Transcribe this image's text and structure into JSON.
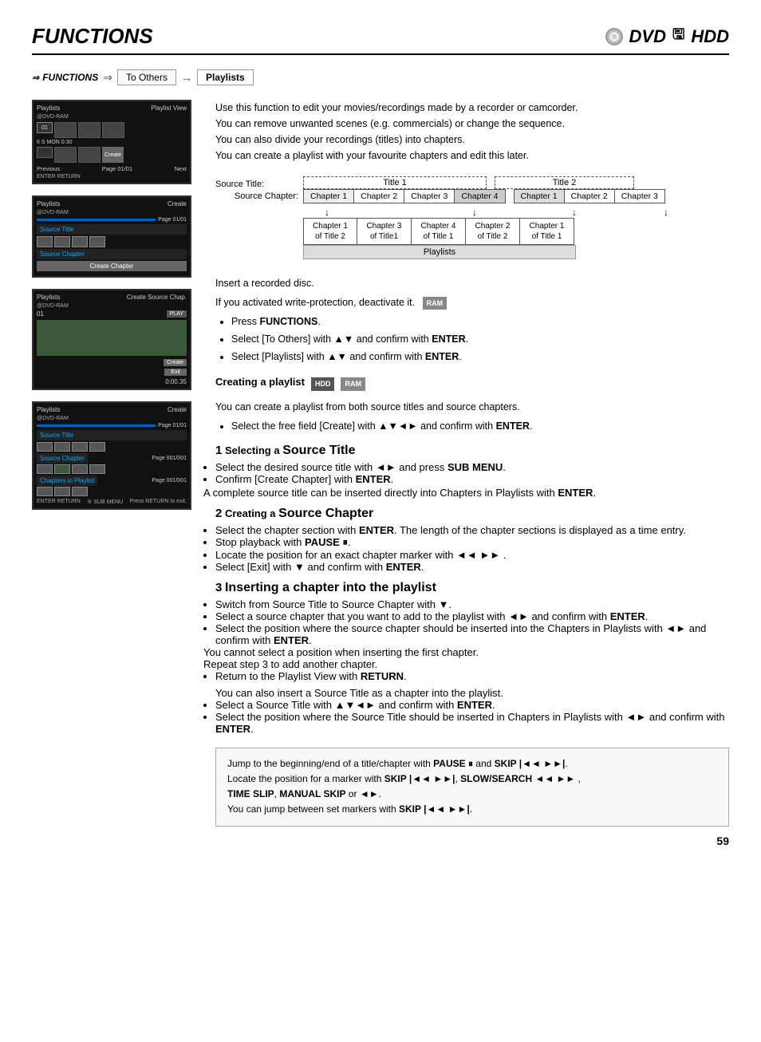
{
  "header": {
    "title": "FUNCTIONS",
    "dvd_label": "DVD",
    "hdd_label": "HDD"
  },
  "breadcrumb": {
    "functions": "FUNCTIONS",
    "to_others": "To Others",
    "playlists": "Playlists"
  },
  "description": [
    "Use this function to edit your movies/recordings made by a recorder or camcorder.",
    "You can remove unwanted scenes (e.g. commercials) or change the sequence.",
    "You can also divide your recordings (titles) into chapters.",
    "You can create a playlist with your favourite chapters and edit this later."
  ],
  "diagram": {
    "source_title_label": "Source Title:",
    "source_chapter_label": "Source Chapter:",
    "title1": "Title 1",
    "title2": "Title 2",
    "chapters_title1": [
      "Chapter 1",
      "Chapter 2",
      "Chapter 3",
      "Chapter 4"
    ],
    "chapters_title2": [
      "Chapter 1",
      "Chapter 2",
      "Chapter 3"
    ],
    "playlist_items": [
      {
        "line1": "Chapter 1",
        "line2": "of Title 2"
      },
      {
        "line1": "Chapter 3",
        "line2": "of Title1"
      },
      {
        "line1": "Chapter 4",
        "line2": "of Title 1"
      },
      {
        "line1": "Chapter 2",
        "line2": "of Title 2"
      },
      {
        "line1": "Chapter 1",
        "line2": "of Title 1"
      }
    ],
    "playlists_label": "Playlists"
  },
  "instructions": {
    "insert": "Insert a recorded disc.",
    "write_protection": "If you activated write-protection, deactivate it.",
    "step1": "Press FUNCTIONS.",
    "step2": "Select [To Others] with ▲▼ and confirm with ENTER.",
    "step3": "Select [Playlists] with ▲▼ and confirm with ENTER.",
    "badge_ram": "RAM"
  },
  "creating_playlist": {
    "heading": "Creating a playlist",
    "badges": [
      "HDD",
      "RAM"
    ],
    "intro": "You can create a playlist from both source titles and source chapters.",
    "step": "Select the free field [Create] with ▲▼◄► and confirm with ENTER."
  },
  "source_title_section": {
    "heading": "1 Selecting a Source Title",
    "steps": [
      "Select the desired source title with ◄► and press SUB MENU.",
      "Confirm [Create Chapter] with ENTER.",
      "A complete source title can be inserted directly into Chapters in Playlists with ENTER."
    ]
  },
  "source_chapter_section": {
    "heading": "2 Creating a Source Chapter",
    "steps": [
      "Select the chapter section with ENTER. The length of the chapter sections is displayed as a time entry.",
      "Stop playback with PAUSE ⏸.",
      "Locate the position for an exact chapter marker with ◄◄ ►► .",
      "Select [Exit] with ▼ and confirm with ENTER."
    ]
  },
  "inserting_section": {
    "heading": "3 Inserting a chapter into the playlist",
    "steps": [
      "Switch from Source Title to Source Chapter with ▼.",
      "Select a source chapter that you want to add to the playlist with ◄► and confirm with ENTER.",
      "Select the position where the source chapter should be inserted into the Chapters in Playlists with ◄► and confirm with ENTER.",
      "You cannot select a position when inserting the first chapter.",
      "Repeat step 3 to add another chapter.",
      "Return to the Playlist View with RETURN."
    ],
    "extra1": "You can also insert a Source Title as a chapter into the playlist.",
    "extra2": "Select a Source Title with ▲▼◄► and confirm with ENTER.",
    "extra3": "Select the position where the Source Title should be inserted in Chapters in Playlists with ◄► and confirm with ENTER."
  },
  "info_box": {
    "line1": "Jump to the beginning/end of a title/chapter with PAUSE ⏸ and SKIP |◄◄ ►► |.",
    "line2": "Locate the position for a marker with SKIP |◄◄ ►► |, SLOW/SEARCH ◄◄ ►► ,",
    "line3": "TIME SLIP, MANUAL SKIP or ◄► .",
    "line4": "You can jump between set markers with SKIP |◄◄ ►► |."
  },
  "page_number": "59",
  "screens": {
    "screen1": {
      "header_left": "Playlists",
      "header_right": "Playlist View",
      "sub": "@DVD-RAM",
      "footer_prev": "Previous",
      "footer_page": "Page 01/01",
      "footer_next": "Next",
      "bottom_left": "ENTER RETURN",
      "time": "6 S MON  0:30",
      "create_label": "Create"
    },
    "screen2": {
      "header_left": "Playlists",
      "header_right": "Create",
      "sub": "@DVD-RAM",
      "source_title": "Source Title",
      "source_chapter": "Source Chapter",
      "create_chapter": "Create Chapter",
      "page": "Page 01/01"
    },
    "screen3": {
      "header_left": "Playlists",
      "header_right": "Create Source Chap.",
      "sub": "@DVD-RAM",
      "play_label": "PLAY",
      "create_label": "Create",
      "exit_label": "Exit",
      "time": "0:00.35",
      "number": "01"
    },
    "screen4": {
      "header_left": "Playlists",
      "header_right": "Create",
      "sub": "@DVD-RAM",
      "source_title": "Source Title",
      "source_chapter": "Source Chapter",
      "chapters_in_playlist": "Chapters in Playlist",
      "page1": "Page 01/01",
      "page2": "Page 001/001",
      "page3": "Page 001/001",
      "bottom_left": "ENTER RETURN",
      "bottom_mid": "⑤ SUB MENU",
      "bottom_right": "Press RETURN to exit."
    }
  }
}
